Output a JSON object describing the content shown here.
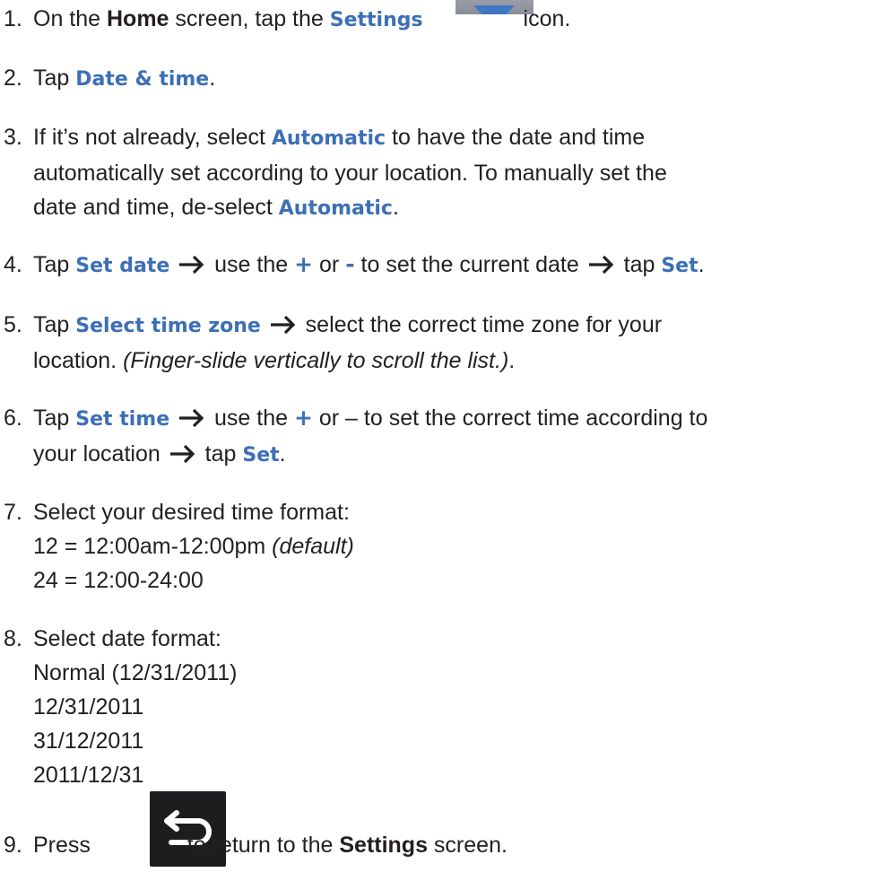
{
  "steps": {
    "s1": {
      "num": "1.",
      "t1": "On the ",
      "home": "Home",
      "t2": " screen, tap the ",
      "settings": "Settings",
      "t3": " icon."
    },
    "s2": {
      "num": "2.",
      "t1": "Tap ",
      "date_time": "Date & time",
      "t2": "."
    },
    "s3": {
      "num": "3.",
      "t1": "If it’s not already, select ",
      "automatic": "Automatic",
      "t2": " to have the date and time",
      "line2": "automatically set according to your location. To manually set the",
      "line3a": "date and time, de-select ",
      "automatic2": "Automatic",
      "line3b": "."
    },
    "s4": {
      "num": "4.",
      "t1": "Tap ",
      "set_date": "Set date",
      "t2": " use the ",
      "plus": "+",
      "t3": " or ",
      "minus": "-",
      "t4": " to set the current date ",
      "t5": " tap ",
      "set": "Set",
      "t6": "."
    },
    "s5": {
      "num": "5.",
      "t1": "Tap ",
      "select_tz": "Select time zone",
      "t2": " select the correct time zone for your",
      "line2a": "location. ",
      "line2_ital": "(Finger-slide vertically to scroll the list.)",
      "line2b": "."
    },
    "s6": {
      "num": "6.",
      "t1": "Tap ",
      "set_time": "Set time",
      "t2": " use the ",
      "plus": "+",
      "t3": " or – to set the correct time according to",
      "line2a": "your location ",
      "line2b": " tap ",
      "set": "Set",
      "line2c": "."
    },
    "s7": {
      "num": "7.",
      "t1": "Select your desired time format:",
      "line2a": "12 = 12:00am-12:00pm ",
      "line2_ital": "(default)",
      "line3": "24 = 12:00-24:00"
    },
    "s8": {
      "num": "8.",
      "t1": "Select date format:",
      "opt1": "Normal (12/31/2011)",
      "opt2": "12/31/2011",
      "opt3": "31/12/2011",
      "opt4": "2011/12/31"
    },
    "s9": {
      "num": "9.",
      "t1": "Press ",
      "t2": " to return to the ",
      "settings": "Settings",
      "t3": " screen."
    }
  },
  "icons": {
    "settings": "gear-icon",
    "back": "back-arrow-icon",
    "step_arrow": "right-arrow-icon"
  },
  "colors": {
    "text": "#231f20",
    "ui_label": "#3d6fb5",
    "gear": "#3f79c6",
    "back_button_bg": "#1d1d1f"
  }
}
